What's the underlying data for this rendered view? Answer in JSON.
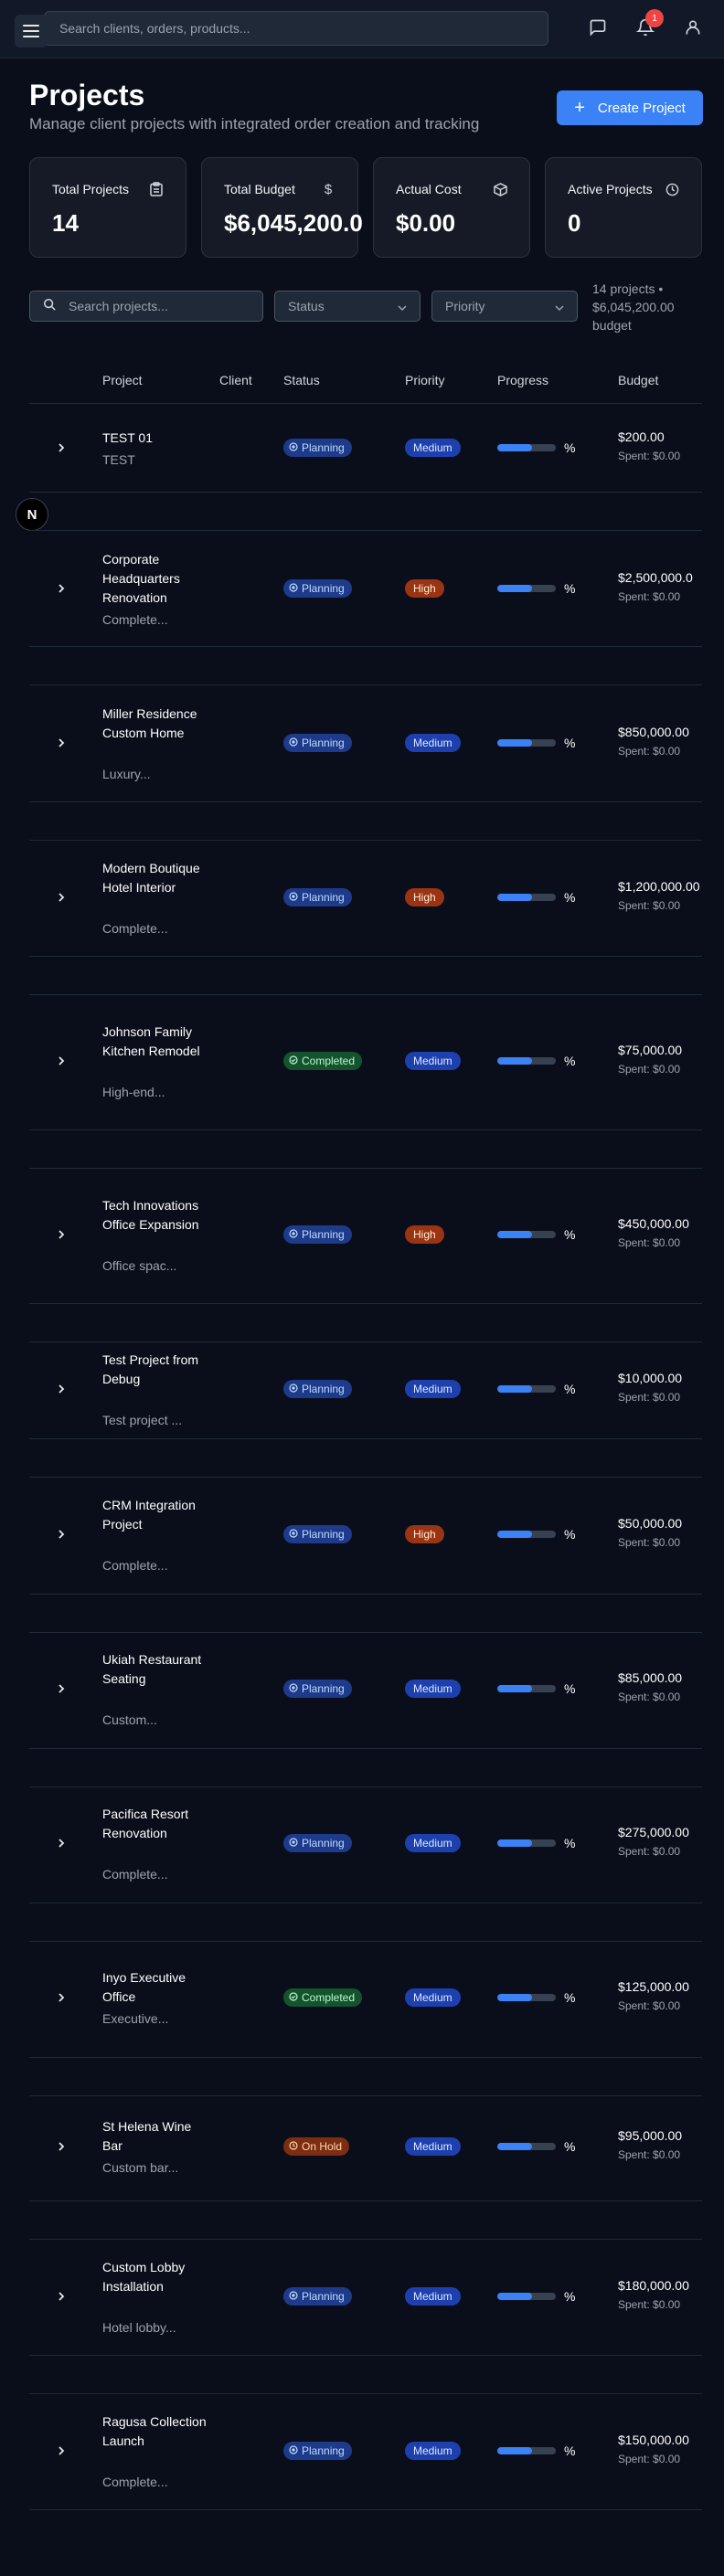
{
  "topbar": {
    "search_placeholder": "Search clients, orders, products...",
    "notification_count": "1"
  },
  "header": {
    "title": "Projects",
    "subtitle": "Manage client projects with integrated order creation and tracking",
    "create_label": "Create Project"
  },
  "stats": [
    {
      "label": "Total Projects",
      "value": "14",
      "icon": "clipboard-icon"
    },
    {
      "label": "Total Budget",
      "value": "$6,045,200.0",
      "icon": "dollar-icon"
    },
    {
      "label": "Actual Cost",
      "value": "$0.00",
      "icon": "box-icon"
    },
    {
      "label": "Active Projects",
      "value": "0",
      "icon": "clock-icon"
    }
  ],
  "filters": {
    "search_placeholder": "Search projects...",
    "status_label": "Status",
    "priority_label": "Priority",
    "summary": "14 projects • $6,045,200.00 budget"
  },
  "table": {
    "headers": [
      "Project",
      "Client",
      "Status",
      "Priority",
      "Progress",
      "Budget"
    ],
    "rows": [
      {
        "name": "TEST 01",
        "desc": "TEST",
        "status": "Planning",
        "priority": "Medium",
        "progress": 0.6,
        "pct": "%",
        "budget": "$200.00",
        "spent": "Spent: $0.00"
      },
      {
        "name": "Corporate Headquarters Renovation",
        "desc": "Complete...",
        "status": "Planning",
        "priority": "High",
        "progress": 0.6,
        "pct": "%",
        "budget": "$2,500,000.0",
        "spent": "Spent: $0.00"
      },
      {
        "name": "Miller Residence Custom Home",
        "desc": "Luxury...",
        "status": "Planning",
        "priority": "Medium",
        "progress": 0.6,
        "pct": "%",
        "budget": "$850,000.00",
        "spent": "Spent: $0.00"
      },
      {
        "name": "Modern Boutique Hotel Interior",
        "desc": "Complete...",
        "status": "Planning",
        "priority": "High",
        "progress": 0.6,
        "pct": "%",
        "budget": "$1,200,000.00",
        "spent": "Spent: $0.00"
      },
      {
        "name": "Johnson Family Kitchen Remodel",
        "desc": "High-end...",
        "status": "Completed",
        "priority": "Medium",
        "progress": 0.6,
        "pct": "%",
        "budget": "$75,000.00",
        "spent": "Spent: $0.00"
      },
      {
        "name": "Tech Innovations Office Expansion",
        "desc": "Office spac...",
        "status": "Planning",
        "priority": "High",
        "progress": 0.6,
        "pct": "%",
        "budget": "$450,000.00",
        "spent": "Spent: $0.00"
      },
      {
        "name": "Test Project from Debug",
        "desc": "Test project ...",
        "status": "Planning",
        "priority": "Medium",
        "progress": 0.6,
        "pct": "%",
        "budget": "$10,000.00",
        "spent": "Spent: $0.00"
      },
      {
        "name": "CRM Integration Project",
        "desc": "Complete...",
        "status": "Planning",
        "priority": "High",
        "progress": 0.6,
        "pct": "%",
        "budget": "$50,000.00",
        "spent": "Spent: $0.00"
      },
      {
        "name": "Ukiah Restaurant Seating",
        "desc": "Custom...",
        "status": "Planning",
        "priority": "Medium",
        "progress": 0.6,
        "pct": "%",
        "budget": "$85,000.00",
        "spent": "Spent: $0.00"
      },
      {
        "name": "Pacifica Resort Renovation",
        "desc": "Complete...",
        "status": "Planning",
        "priority": "Medium",
        "progress": 0.6,
        "pct": "%",
        "budget": "$275,000.00",
        "spent": "Spent: $0.00"
      },
      {
        "name": "Inyo Executive Office",
        "desc": "Executive...",
        "status": "Completed",
        "priority": "Medium",
        "progress": 0.6,
        "pct": "%",
        "budget": "$125,000.00",
        "spent": "Spent: $0.00"
      },
      {
        "name": "St Helena Wine Bar",
        "desc": "Custom bar...",
        "status": "On Hold",
        "priority": "Medium",
        "progress": 0.6,
        "pct": "%",
        "budget": "$95,000.00",
        "spent": "Spent: $0.00"
      },
      {
        "name": "Custom Lobby Installation",
        "desc": "Hotel lobby...",
        "status": "Planning",
        "priority": "Medium",
        "progress": 0.6,
        "pct": "%",
        "budget": "$180,000.00",
        "spent": "Spent: $0.00"
      },
      {
        "name": "Ragusa Collection Launch",
        "desc": "Complete...",
        "status": "Planning",
        "priority": "Medium",
        "progress": 0.6,
        "pct": "%",
        "budget": "$150,000.00",
        "spent": "Spent: $0.00"
      }
    ]
  },
  "fab_label": "N"
}
